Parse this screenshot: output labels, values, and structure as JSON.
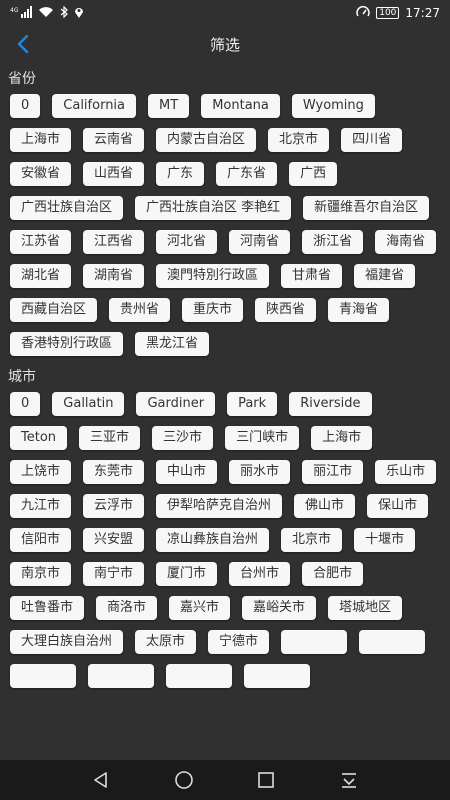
{
  "status_bar": {
    "time": "17:27",
    "battery": "100",
    "icons": [
      "signal-icon",
      "wifi-icon",
      "bluetooth-icon",
      "location-icon",
      "speedometer-icon"
    ]
  },
  "header": {
    "title": "筛选",
    "back_icon": "chevron-left-icon"
  },
  "provinces": {
    "label": "省份",
    "items": [
      "0",
      "California",
      "MT",
      "Montana",
      "Wyoming",
      "上海市",
      "云南省",
      "内蒙古自治区",
      "北京市",
      "四川省",
      "安徽省",
      "山西省",
      "广东",
      "广东省",
      "广西",
      "广西壮族自治区",
      "广西壮族自治区 李艳红",
      "新疆维吾尔自治区",
      "江苏省",
      "江西省",
      "河北省",
      "河南省",
      "浙江省",
      "海南省",
      "湖北省",
      "湖南省",
      "澳門特別行政區",
      "甘肃省",
      "福建省",
      "西藏自治区",
      "贵州省",
      "重庆市",
      "陕西省",
      "青海省",
      "香港特別行政區",
      "黑龙江省"
    ]
  },
  "cities": {
    "label": "城市",
    "items": [
      "0",
      "Gallatin",
      "Gardiner",
      "Park",
      "Riverside",
      "Teton",
      "三亚市",
      "三沙市",
      "三门峡市",
      "上海市",
      "上饶市",
      "东莞市",
      "中山市",
      "丽水市",
      "丽江市",
      "乐山市",
      "九江市",
      "云浮市",
      "伊犁哈萨克自治州",
      "佛山市",
      "保山市",
      "信阳市",
      "兴安盟",
      "凉山彝族自治州",
      "北京市",
      "十堰市",
      "南京市",
      "南宁市",
      "厦门市",
      "台州市",
      "合肥市",
      "吐鲁番市",
      "商洛市",
      "嘉兴市",
      "嘉峪关市",
      "塔城地区",
      "大理白族自治州",
      "太原市",
      "宁德市",
      "",
      "",
      "",
      "",
      "",
      ""
    ]
  },
  "nav_bar": {
    "buttons": [
      "back-triangle-icon",
      "home-circle-icon",
      "recents-square-icon",
      "download-icon"
    ]
  },
  "colors": {
    "background": "#303030",
    "tag_bg": "#f7f7f7",
    "accent": "#1e88e5",
    "nav_bg": "#1a1a1a"
  }
}
